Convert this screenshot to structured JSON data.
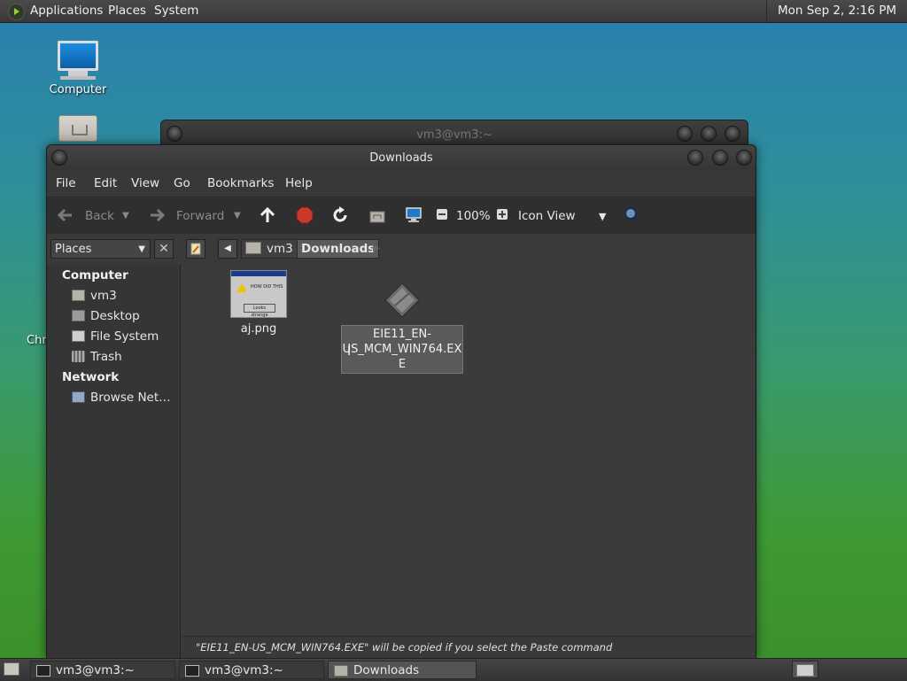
{
  "top_panel": {
    "menus": [
      "Applications",
      "Places",
      "System"
    ],
    "clock": "Mon Sep  2,  2:16 PM"
  },
  "desktop": {
    "icons": [
      {
        "label": "Computer"
      },
      {
        "label": "Chr"
      }
    ]
  },
  "background_window": {
    "title": "vm3@vm3:~"
  },
  "window": {
    "title": "Downloads",
    "menus": [
      "File",
      "Edit",
      "View",
      "Go",
      "Bookmarks",
      "Help"
    ],
    "toolbar": {
      "back": "Back",
      "forward": "Forward",
      "zoom": "100%",
      "view_mode": "Icon View"
    },
    "location": {
      "crumbs": [
        "vm3",
        "Downloads"
      ]
    },
    "sidebar": {
      "places_label": "Places",
      "close": "✕",
      "sections": [
        {
          "title": "Computer",
          "items": [
            "vm3",
            "Desktop",
            "File System",
            "Trash"
          ]
        },
        {
          "title": "Network",
          "items": [
            "Browse Net…"
          ]
        }
      ]
    },
    "files": [
      {
        "name": "aj.png",
        "thumbnail_text": "HOW DID THIS",
        "thumbnail_button": "Looks strange"
      },
      {
        "name_lines": [
          "EIE11_EN-",
          "US_MCM_WIN764.EX",
          "E"
        ]
      }
    ],
    "status": "\"EIE11_EN-US_MCM_WIN764.EXE\" will be copied if you select the Paste command"
  },
  "taskbar": {
    "tasks": [
      {
        "label": "vm3@vm3:~"
      },
      {
        "label": "vm3@vm3:~"
      },
      {
        "label": "Downloads"
      }
    ]
  },
  "colors": {
    "window_bg": "#3c3c3c",
    "selection": "#5a5a5a"
  }
}
